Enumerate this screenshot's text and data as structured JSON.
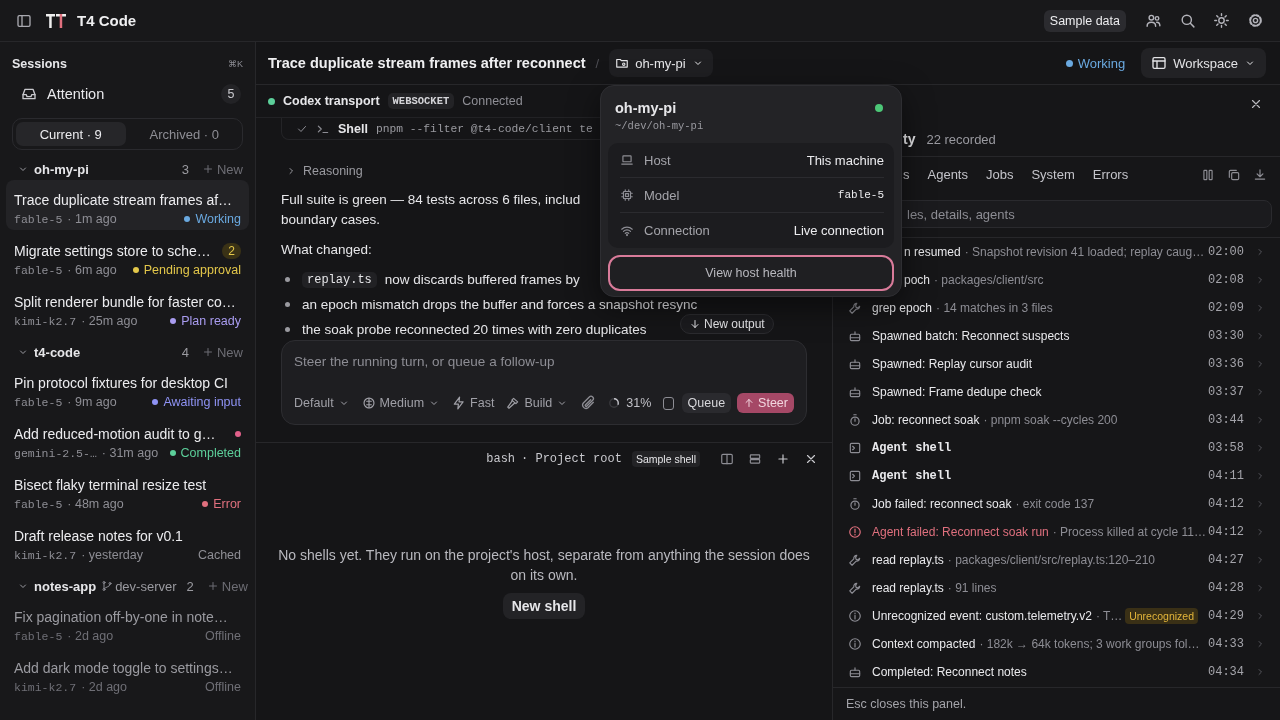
{
  "app": {
    "title": "T4 Code",
    "sample_button": "Sample data"
  },
  "sidebar": {
    "heading": "Sessions",
    "shortcut": "⌘K",
    "attention": {
      "label": "Attention",
      "count": "5"
    },
    "filters": [
      {
        "label": "Current · 9",
        "selected": true
      },
      {
        "label": "Archived · 0",
        "selected": false
      }
    ],
    "groups": [
      {
        "name": "oh-my-pi",
        "count": "3",
        "new_label": "New",
        "expanded": true,
        "sessions": [
          {
            "title": "Trace duplicate stream frames af…",
            "model": "fable-5",
            "time": "· 1m ago",
            "status": "Working",
            "color": "#6aa9e0",
            "selected": true,
            "inactive": false,
            "unread": false
          },
          {
            "title": "Migrate settings store to sche…",
            "badge": "2",
            "model": "fable-5",
            "time": "· 6m ago",
            "status": "Pending approval",
            "color": "#e3c74a",
            "selected": false,
            "inactive": false,
            "unread": false
          },
          {
            "title": "Split renderer bundle for faster co…",
            "model": "kimi-k2.7",
            "time": "· 25m ago",
            "status": "Plan ready",
            "color": "#a99cf0",
            "selected": false,
            "inactive": false,
            "unread": false
          }
        ]
      },
      {
        "name": "t4-code",
        "count": "4",
        "new_label": "New",
        "expanded": true,
        "sessions": [
          {
            "title": "Pin protocol fixtures for desktop CI",
            "model": "fable-5",
            "time": "· 9m ago",
            "status": "Awaiting input",
            "color": "#8f93f5",
            "selected": false,
            "inactive": false,
            "unread": false
          },
          {
            "title": "Add reduced-motion audit to g…",
            "model": "gemini-2.5-…",
            "time": "· 31m ago",
            "status": "Completed",
            "color": "#5ccf9a",
            "selected": false,
            "inactive": false,
            "unread": true
          },
          {
            "title": "Bisect flaky terminal resize test",
            "model": "fable-5",
            "time": "· 48m ago",
            "status": "Error",
            "color": "#e0707e",
            "selected": false,
            "inactive": false,
            "unread": false
          },
          {
            "title": "Draft release notes for v0.1",
            "model": "kimi-k2.7",
            "time": "· yesterday",
            "status": "Cached",
            "selected": false,
            "inactive": false,
            "unread": false
          }
        ]
      },
      {
        "name": "notes-app",
        "branch": "dev-server",
        "count": "2",
        "new_label": "New",
        "expanded": true,
        "sessions": [
          {
            "title": "Fix pagination off-by-one in note…",
            "model": "fable-5",
            "time": "· 2d ago",
            "status": "Offline",
            "selected": false,
            "inactive": true,
            "unread": false
          },
          {
            "title": "Add dark mode toggle to settings…",
            "model": "kimi-k2.7",
            "time": "· 2d ago",
            "status": "Offline",
            "selected": false,
            "inactive": true,
            "unread": false
          }
        ]
      }
    ]
  },
  "header": {
    "title": "Trace duplicate stream frames after reconnect",
    "separator": "/",
    "project": "oh-my-pi",
    "status": {
      "label": "Working",
      "color": "#6aa9e0"
    },
    "workspace": "Workspace"
  },
  "transport": {
    "name": "Codex transport",
    "protocol": "WEBSOCKET",
    "state": "Connected",
    "color": "#5ccf9a"
  },
  "messages": {
    "shell": {
      "done": true,
      "label": "Shell",
      "command": "pnpm --filter @t4-code/client te"
    },
    "reasoning": "Reasoning",
    "paragraph": [
      "Full suite is green — 84 tests across 6 files, includ",
      "boundary cases."
    ],
    "heading": "What changed:",
    "bullets": [
      {
        "code": "replay.ts",
        "text": "now discards buffered frames by"
      },
      {
        "text": "an epoch mismatch drops the buffer and forces a snapshot resync"
      },
      {
        "text": "the soak probe reconnected 20 times with zero duplicates"
      }
    ],
    "new_output": "New output"
  },
  "composer": {
    "placeholder": "Steer the running turn, or queue a follow-up",
    "mode": "Default",
    "effort": "Medium",
    "speed": "Fast",
    "agent": "Build",
    "context": {
      "level": 0.31,
      "reading": "31%"
    },
    "queue_checked": false,
    "queue": "Queue",
    "steer": "Steer"
  },
  "terminal": {
    "shell": "bash",
    "location": "· Project root",
    "badge": "Sample shell",
    "empty": "No shells yet. They run on the project's host, separate from anything the session does on its own.",
    "new_shell": "New shell"
  },
  "popup": {
    "name": "oh-my-pi",
    "path": "~/dev/oh-my-pi",
    "color": "#4cc777",
    "rows": [
      {
        "kind": "text",
        "label": "Host",
        "value": "This machine"
      },
      {
        "kind": "code",
        "label": "Model",
        "value": "fable-5"
      },
      {
        "kind": "text",
        "label": "Connection",
        "value": "Live connection"
      }
    ],
    "action": "View host health"
  },
  "activity": {
    "heading": {
      "text": "ty",
      "cut": true
    },
    "count": "22 recorded",
    "tabs_cut": true,
    "tabs": [
      {
        "label": "s"
      },
      {
        "label": "Agents"
      },
      {
        "label": "Jobs"
      },
      {
        "label": "System"
      },
      {
        "label": "Errors"
      }
    ],
    "search": {
      "placeholder": "les, details, agents",
      "cut": true
    },
    "rows": [
      {
        "kind": "cut",
        "title": "n resumed",
        "detail": "· Snapshot revision 41 loaded; replay caug…",
        "time": "02:00"
      },
      {
        "kind": "cut",
        "title": "poch",
        "detail": "· packages/client/src",
        "time": "02:08"
      },
      {
        "kind": "tool",
        "title": "grep epoch",
        "detail": "· 14 matches in 3 files",
        "time": "02:09"
      },
      {
        "kind": "agent",
        "title": "Spawned batch: Reconnect suspects",
        "time": "03:30"
      },
      {
        "kind": "agent",
        "title": "Spawned: Replay cursor audit",
        "time": "03:36"
      },
      {
        "kind": "agent",
        "title": "Spawned: Frame dedupe check",
        "time": "03:37"
      },
      {
        "kind": "job",
        "title": "Job: reconnect soak",
        "detail": "· pnpm soak --cycles 200",
        "time": "03:44"
      },
      {
        "kind": "shell",
        "title": "Agent shell",
        "time": "03:58"
      },
      {
        "kind": "shell",
        "title": "Agent shell",
        "time": "04:11"
      },
      {
        "kind": "job",
        "title": "Job failed: reconnect soak",
        "detail": "· exit code 137",
        "time": "04:12"
      },
      {
        "kind": "error",
        "title": "Agent failed: Reconnect soak run",
        "detail": "· Process killed at cycle 11…",
        "time": "04:12"
      },
      {
        "kind": "tool",
        "title": "read replay.ts",
        "detail": "· packages/client/src/replay.ts:120–210",
        "time": "04:27"
      },
      {
        "kind": "tool",
        "title": "read replay.ts",
        "detail": "· 91 lines",
        "time": "04:28"
      },
      {
        "kind": "info",
        "title": "Unrecognized event: custom.telemetry.v2",
        "detail": "· T…",
        "badge": "Unrecognized",
        "time": "04:29"
      },
      {
        "kind": "info",
        "title": "Context compacted",
        "detail": "· 182k → 64k tokens; 3 work groups fol…",
        "time": "04:33"
      },
      {
        "kind": "agent",
        "title": "Completed: Reconnect notes",
        "time": "04:34"
      }
    ],
    "footer": "Esc closes this panel."
  }
}
